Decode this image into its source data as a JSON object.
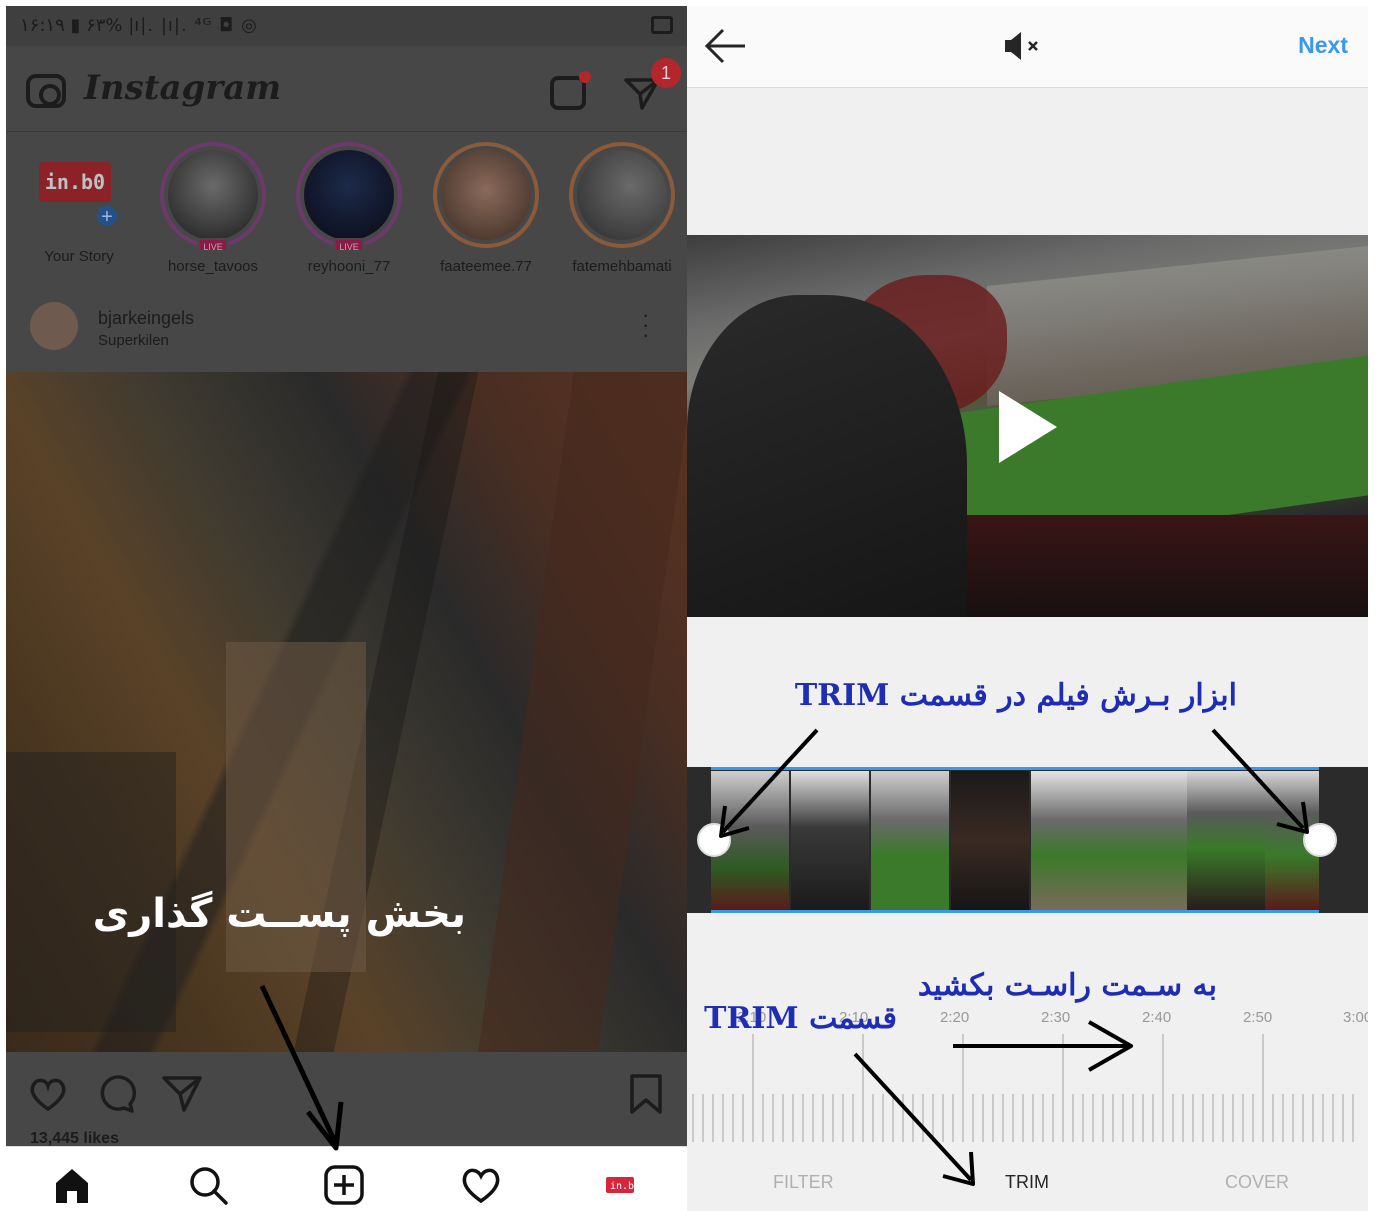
{
  "left": {
    "statusbar": {
      "text": "۱۶:۱۹ ▮ ۶۳% |ı|. |ı|. ⁴ᴳ ◘ ◎"
    },
    "header": {
      "logo": "Instagram",
      "dm_badge": "1"
    },
    "stories": [
      {
        "name": "Your Story",
        "sign": "in.b0"
      },
      {
        "name": "horse_tavoos",
        "live": "LIVE"
      },
      {
        "name": "reyhooni_77",
        "live": "LIVE"
      },
      {
        "name": "faateemee.77"
      },
      {
        "name": "fatemehbamati"
      }
    ],
    "post": {
      "username": "bjarkeingels",
      "location": "Superkilen",
      "likes": "13,445 likes"
    },
    "annotation": "بخش پســت گذاری",
    "icons": [
      "camera-icon",
      "igtv-icon",
      "direct-message-icon",
      "heart-icon",
      "comment-icon",
      "share-icon",
      "bookmark-icon",
      "home-icon",
      "search-icon",
      "add-post-icon",
      "activity-icon",
      "profile-icon"
    ],
    "colors": {
      "dim_overlay": "#4a4a4a",
      "live_badge": "#8a1a4a",
      "badge_red": "#b3262b"
    }
  },
  "right": {
    "header": {
      "next": "Next"
    },
    "annotations": {
      "top": "ابزار بـرش فیلم در قسمت TRIM",
      "middle": "به سـمت راسـت بکشید",
      "bottom": "قسمت TRIM"
    },
    "ruler_labels": [
      "2:10",
      "2:20",
      "2:30",
      "2:40",
      "2:50",
      "3:00"
    ],
    "tabs": [
      "FILTER",
      "TRIM",
      "COVER"
    ],
    "active_tab": "TRIM",
    "colors": {
      "accent": "#3897f0",
      "annotation_text": "#1e2db4"
    }
  }
}
